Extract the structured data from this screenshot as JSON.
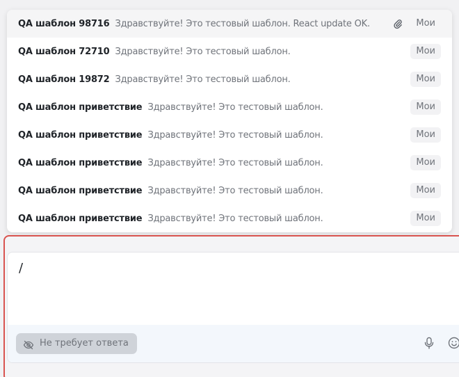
{
  "templates": [
    {
      "title": "QA шаблон 98716",
      "text": "Здравствуйте! Это тестовый шаблон. React update OK.",
      "badge": "Мои",
      "has_attachment": true,
      "active": true
    },
    {
      "title": "QA шаблон 72710",
      "text": "Здравствуйте! Это тестовый шаблон.",
      "badge": "Мои"
    },
    {
      "title": "QA шаблон 19872",
      "text": "Здравствуйте! Это тестовый шаблон.",
      "badge": "Мои"
    },
    {
      "title": "QA шаблон приветствие",
      "text": "Здравствуйте! Это тестовый шаблон.",
      "badge": "Мои"
    },
    {
      "title": "QA шаблон приветствие",
      "text": "Здравствуйте! Это тестовый шаблон.",
      "badge": "Мои"
    },
    {
      "title": "QA шаблон приветствие",
      "text": "Здравствуйте! Это тестовый шаблон.",
      "badge": "Мои"
    },
    {
      "title": "QA шаблон приветствие",
      "text": "Здравствуйте! Это тестовый шаблон.",
      "badge": "Мои"
    },
    {
      "title": "QA шаблон приветствие",
      "text": "Здравствуйте! Это тестовый шаблон.",
      "badge": "Мои"
    }
  ],
  "composer": {
    "input_value": "/",
    "no_reply_label": "Не требует ответа"
  },
  "icons": {
    "attachment": "paperclip-icon",
    "no_reply": "eye-off-icon",
    "mic": "microphone-icon",
    "emoji": "emoji-icon"
  },
  "colors": {
    "focus_border": "#d9534f",
    "popup_bg": "#ffffff",
    "active_row_bg": "#f5f5f6",
    "footer_bg": "#f3f7fc"
  }
}
